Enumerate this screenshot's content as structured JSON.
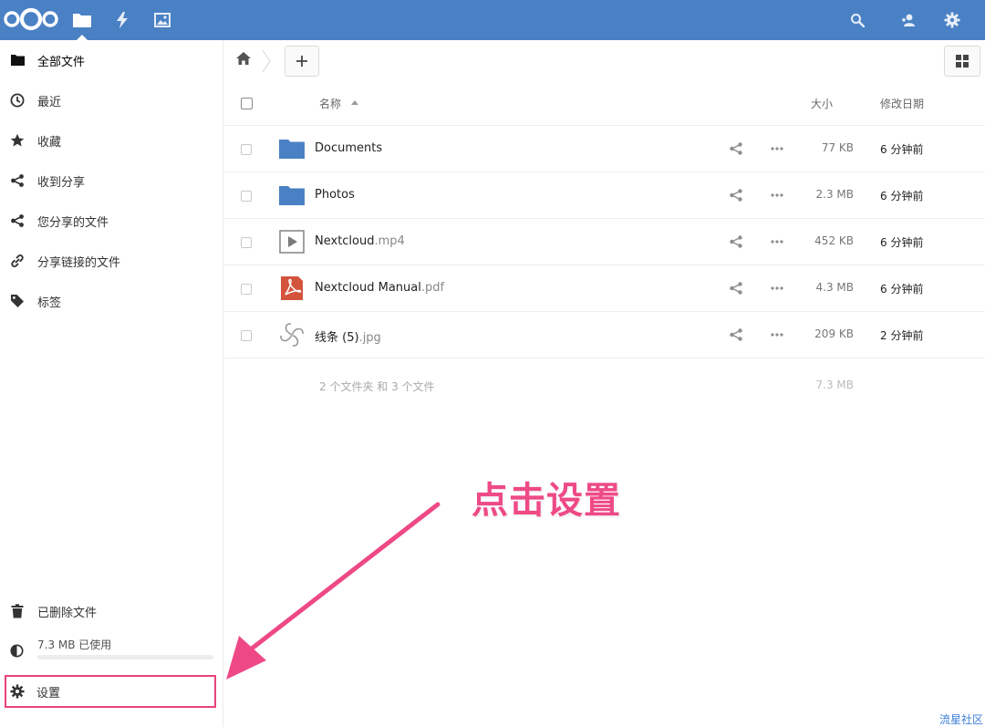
{
  "header": {
    "apps": [
      {
        "name": "files-app",
        "icon": "folder-icon",
        "active": true
      },
      {
        "name": "activity-app",
        "icon": "lightning-icon",
        "active": false
      },
      {
        "name": "gallery-app",
        "icon": "image-icon",
        "active": false
      }
    ],
    "right_icons": [
      "search-icon",
      "contacts-icon",
      "gear-icon"
    ],
    "accent_color": "#4a81c5"
  },
  "sidebar": {
    "items": [
      {
        "label": "全部文件",
        "icon": "folder-icon"
      },
      {
        "label": "最近",
        "icon": "clock-icon"
      },
      {
        "label": "收藏",
        "icon": "star-icon"
      },
      {
        "label": "收到分享",
        "icon": "share-icon"
      },
      {
        "label": "您分享的文件",
        "icon": "share-icon"
      },
      {
        "label": "分享链接的文件",
        "icon": "link-icon"
      },
      {
        "label": "标签",
        "icon": "tag-icon"
      }
    ],
    "trash_label": "已删除文件",
    "quota_label": "7.3 MB 已使用",
    "quota_fraction": 0.0,
    "settings_label": "设置"
  },
  "table": {
    "headers": {
      "name": "名称",
      "size": "大小",
      "modified": "修改日期"
    },
    "rows": [
      {
        "base": "Documents",
        "ext": "",
        "type": "folder",
        "size": "77 KB",
        "modified": "6 分钟前"
      },
      {
        "base": "Photos",
        "ext": "",
        "type": "folder",
        "size": "2.3 MB",
        "modified": "6 分钟前"
      },
      {
        "base": "Nextcloud",
        "ext": ".mp4",
        "type": "video",
        "size": "452 KB",
        "modified": "6 分钟前"
      },
      {
        "base": "Nextcloud Manual",
        "ext": ".pdf",
        "type": "pdf",
        "size": "4.3 MB",
        "modified": "6 分钟前"
      },
      {
        "base": "线条 (5)",
        "ext": ".jpg",
        "type": "image",
        "size": "209 KB",
        "modified": "2 分钟前"
      }
    ],
    "summary_text": "2 个文件夹 和 3 个文件",
    "summary_size": "7.3 MB"
  },
  "annotation": {
    "text": "点击设置",
    "color": "#ee4a86"
  },
  "watermark": "流星社区"
}
